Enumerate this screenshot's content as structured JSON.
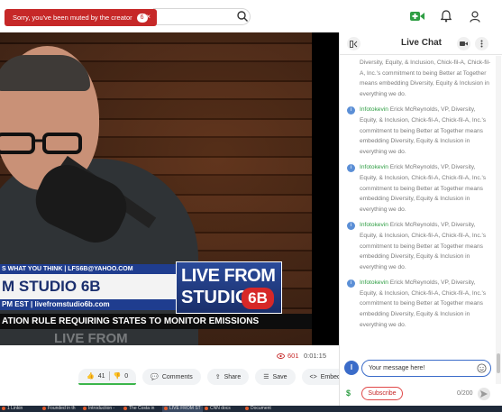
{
  "toast": {
    "text": "Sorry, you've been muted by the creator",
    "badge": "6",
    "close": "×"
  },
  "search": {
    "placeholder": ""
  },
  "video": {
    "email_bar": "S WHAT YOU THINK | LFS6B@YAHOO.COM",
    "title_bar": "M STUDIO 6B",
    "time_bar": "PM EST | livefromstudio6b.com",
    "logo_line1": "LIVE FROM",
    "logo_line2": "STUDIO",
    "logo_badge": "6B",
    "ticker": "ATION RULE REQUIRING STATES TO MONITOR EMISSIONS",
    "watermark": "LIVE FROM"
  },
  "stats": {
    "views": "601",
    "duration": "0:01:15"
  },
  "actions": {
    "likes": "41",
    "dislikes": "0",
    "comments": "Comments",
    "share": "Share",
    "save": "Save",
    "embed": "Embed"
  },
  "chat": {
    "title": "Live Chat",
    "messages": [
      {
        "user": "",
        "text": "Diversity, Equity, & Inclusion, Chick-fil-A, Chick-fil-A, Inc.'s commitment to being Better at Together means embedding Diversity, Equity & Inclusion in everything we do."
      },
      {
        "user": "Infotokevin",
        "text": "Erick McReynolds, VP, Diversity, Equity, & Inclusion, Chick-fil-A, Chick-fil-A, Inc.'s commitment to being Better at Together means embedding Diversity, Equity & Inclusion in everything we do."
      },
      {
        "user": "Infotokevin",
        "text": "Erick McReynolds, VP, Diversity, Equity, & Inclusion, Chick-fil-A, Chick-fil-A, Inc.'s commitment to being Better at Together means embedding Diversity, Equity & Inclusion in everything we do."
      },
      {
        "user": "Infotokevin",
        "text": "Erick McReynolds, VP, Diversity, Equity, & Inclusion, Chick-fil-A, Chick-fil-A, Inc.'s commitment to being Better at Together means embedding Diversity, Equity & Inclusion in everything we do."
      },
      {
        "user": "Infotokevin",
        "text": "Erick McReynolds, VP, Diversity, Equity, & Inclusion, Chick-fil-A, Chick-fil-A, Inc.'s commitment to being Better at Together means embedding Diversity, Equity & Inclusion in everything we do."
      }
    ],
    "input_placeholder": "Your message here!",
    "avatar_letter": "I",
    "subscribe": "Subscribe",
    "counter": "0/200",
    "dollar": "$"
  },
  "taskbar": [
    "1 Linkin",
    "Founded in th",
    "Introduction -",
    "The Costa in",
    "LIVE FROM ST",
    "CNN docs",
    "Document"
  ],
  "colors": {
    "accent": "#2f9e44",
    "muted_red": "#c62828",
    "link_blue": "#3b6cc9"
  }
}
